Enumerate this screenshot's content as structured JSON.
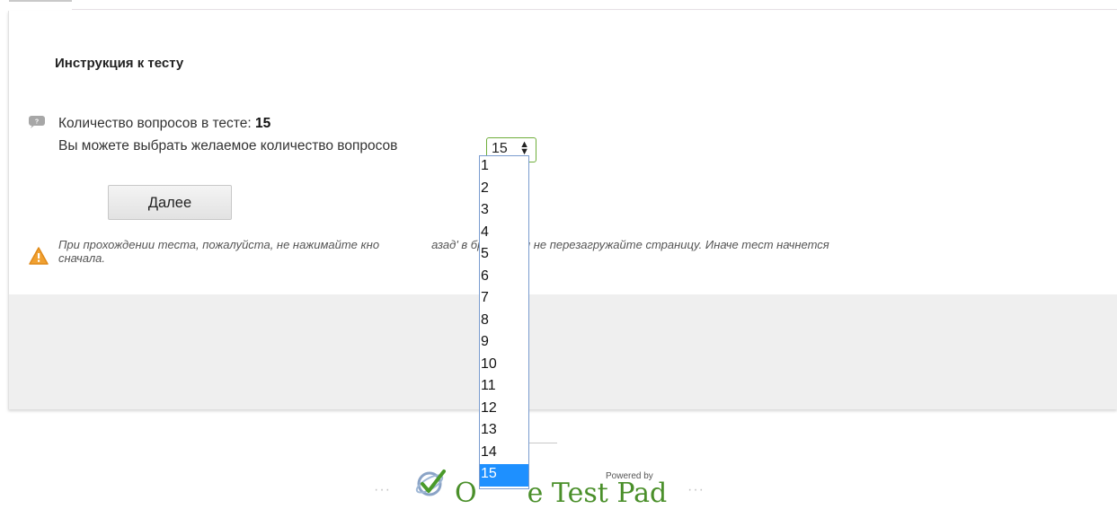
{
  "instructions": {
    "title": "Инструкция к тесту",
    "question_count_label": "Количество вопросов в тесте:",
    "question_count_value": "15",
    "choose_label": "Вы можете выбрать желаемое количество вопросов",
    "next_button": "Далее",
    "warning_part1": "При прохождении теста, пожалуйста, не нажимайте кно",
    "warning_part2": "азад' в браузере и не перезагружайте страницу. Иначе тест начнется",
    "warning_line2": "сначала."
  },
  "question_select": {
    "selected": "15",
    "arrow": "▲▼",
    "options": [
      "1",
      "2",
      "3",
      "4",
      "5",
      "6",
      "7",
      "8",
      "9",
      "10",
      "11",
      "12",
      "13",
      "14",
      "15"
    ],
    "highlighted": "15"
  },
  "footer": {
    "dots": "···",
    "powered_by": "Powered by",
    "brand": "Online Test Pad",
    "visible_brand_start": "O",
    "visible_brand_end": "e Test Pad"
  },
  "colors": {
    "accent_green": "#6fae3b",
    "selection_blue": "#1e90ff",
    "warning_orange": "#f0a030"
  },
  "icons": {
    "help": "question-bubble-icon",
    "warning": "warning-triangle-icon",
    "logo": "online-test-pad-logo-icon"
  }
}
